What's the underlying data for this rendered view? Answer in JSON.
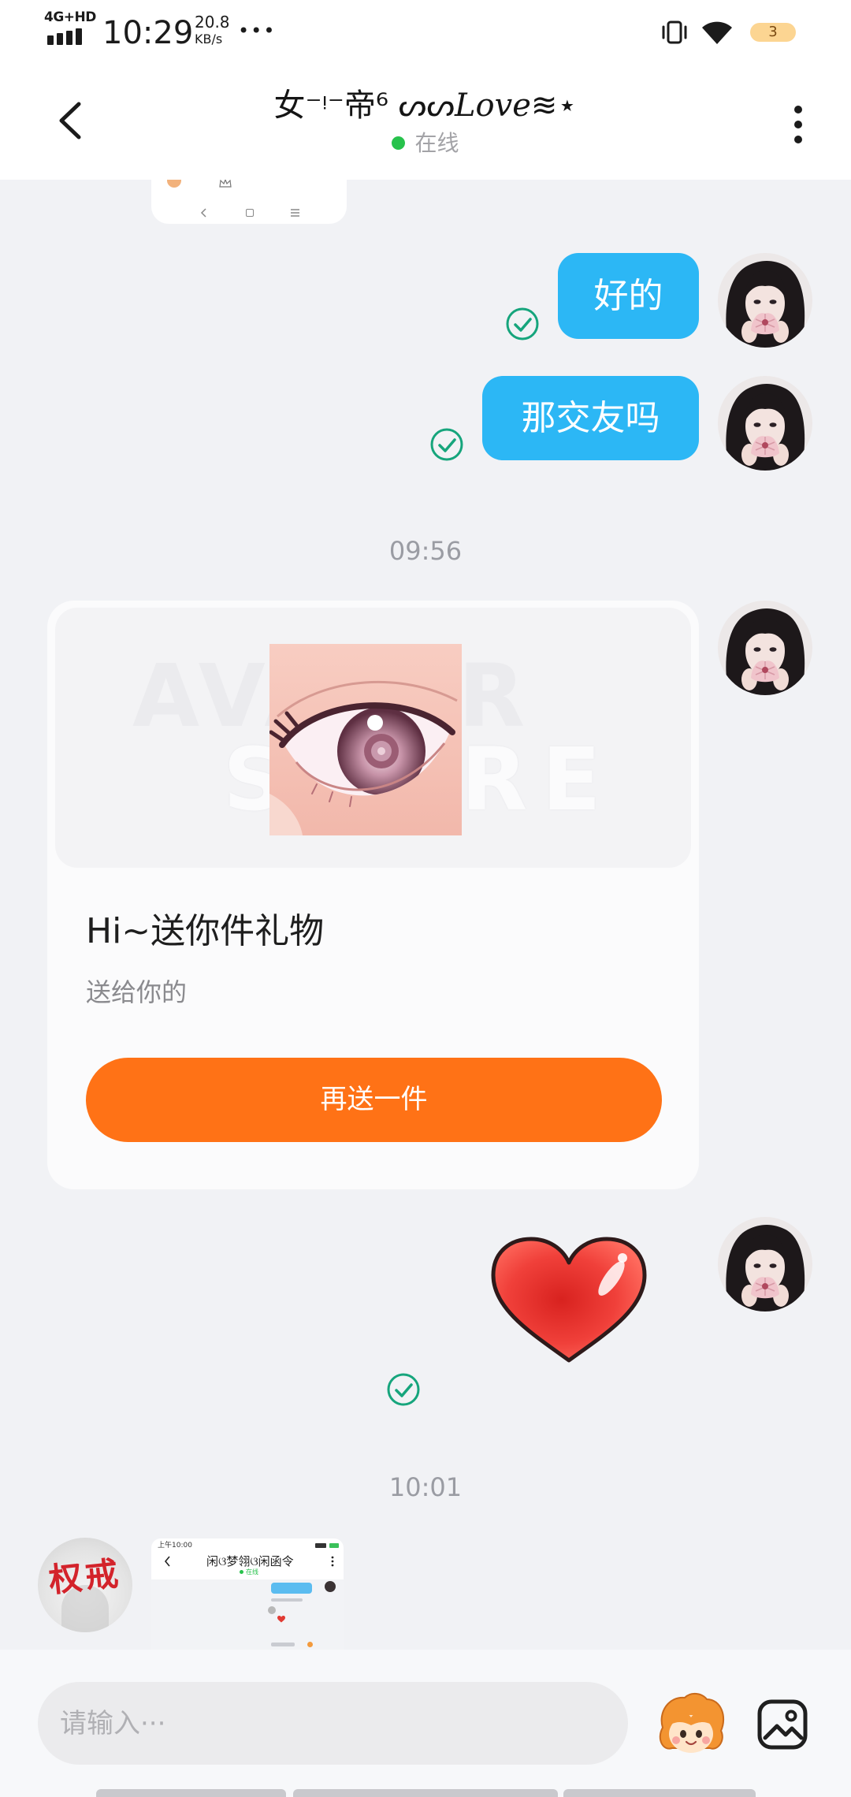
{
  "status_bar": {
    "network": "4G+HD",
    "time": "10:29",
    "speed_value": "20.8",
    "speed_unit": "KB/s",
    "more": "•••",
    "battery_level": "3",
    "icons": [
      "signal-icon",
      "vibrate-icon",
      "wifi-icon",
      "battery-icon"
    ]
  },
  "header": {
    "back_icon": "chevron-left-icon",
    "title_prefix": "女⁻ᵎ⁻帝⁶ ᔕᔕ",
    "title_script": "Love",
    "title_suffix": "≋⋆",
    "status": "在线",
    "status_color": "#27c24c",
    "menu_icon": "more-vertical-icon"
  },
  "top_image": {
    "icons": [
      "avatar-icon",
      "crown-icon",
      "back-nav-icon",
      "home-nav-icon",
      "menu-nav-icon"
    ]
  },
  "messages": [
    {
      "direction": "outgoing",
      "type": "text",
      "text": "好的",
      "receipt_icon": "check-circle-icon"
    },
    {
      "direction": "outgoing",
      "type": "text",
      "text": "那交友吗",
      "receipt_icon": "check-circle-icon"
    },
    {
      "type": "timestamp",
      "text": "09:56"
    },
    {
      "direction": "outgoing",
      "type": "gift",
      "watermark": [
        "AVATAR",
        "STORE"
      ],
      "title": "Hi~送你件礼物",
      "subtitle": "送给你的",
      "button_label": "再送一件"
    },
    {
      "direction": "outgoing",
      "type": "sticker",
      "sticker": "red-heart-icon",
      "receipt_icon": "check-circle-icon"
    },
    {
      "type": "timestamp",
      "text": "10:01"
    },
    {
      "direction": "incoming",
      "type": "image",
      "avatar_text": "权戒",
      "preview": {
        "time": "上午10:00",
        "title": "闲ଓ梦翎ଓ闲函令",
        "status": "在线"
      }
    }
  ],
  "composer": {
    "placeholder": "请输入···",
    "emoji_icon": "mascot-emoji-icon",
    "image_icon": "image-icon"
  },
  "colors": {
    "bubble": "#2cb7f5",
    "button": "#ff7216",
    "read_check": "#16a57c",
    "chat_bg": "#f1f2f5",
    "header_bg": "#ffffff",
    "online": "#27c24c"
  }
}
